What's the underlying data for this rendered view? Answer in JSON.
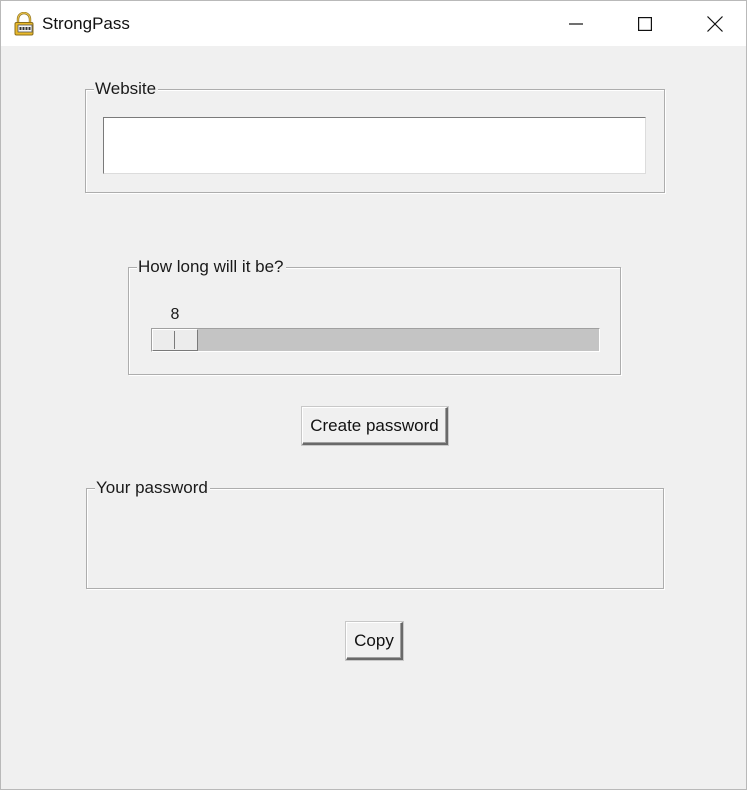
{
  "window": {
    "title": "StrongPass",
    "app_icon": "padlock-icon",
    "controls": {
      "minimize_icon": "minimize-icon",
      "maximize_icon": "maximize-icon",
      "close_icon": "close-icon"
    }
  },
  "website": {
    "label": "Website",
    "value": ""
  },
  "length": {
    "label": "How long will it be?",
    "value": "8"
  },
  "actions": {
    "create_label": "Create password",
    "copy_label": "Copy"
  },
  "result": {
    "label": "Your password",
    "value": ""
  },
  "colors": {
    "window_bg": "#f0f0f0",
    "titlebar_bg": "#ffffff",
    "trough": "#c4c4c4"
  }
}
